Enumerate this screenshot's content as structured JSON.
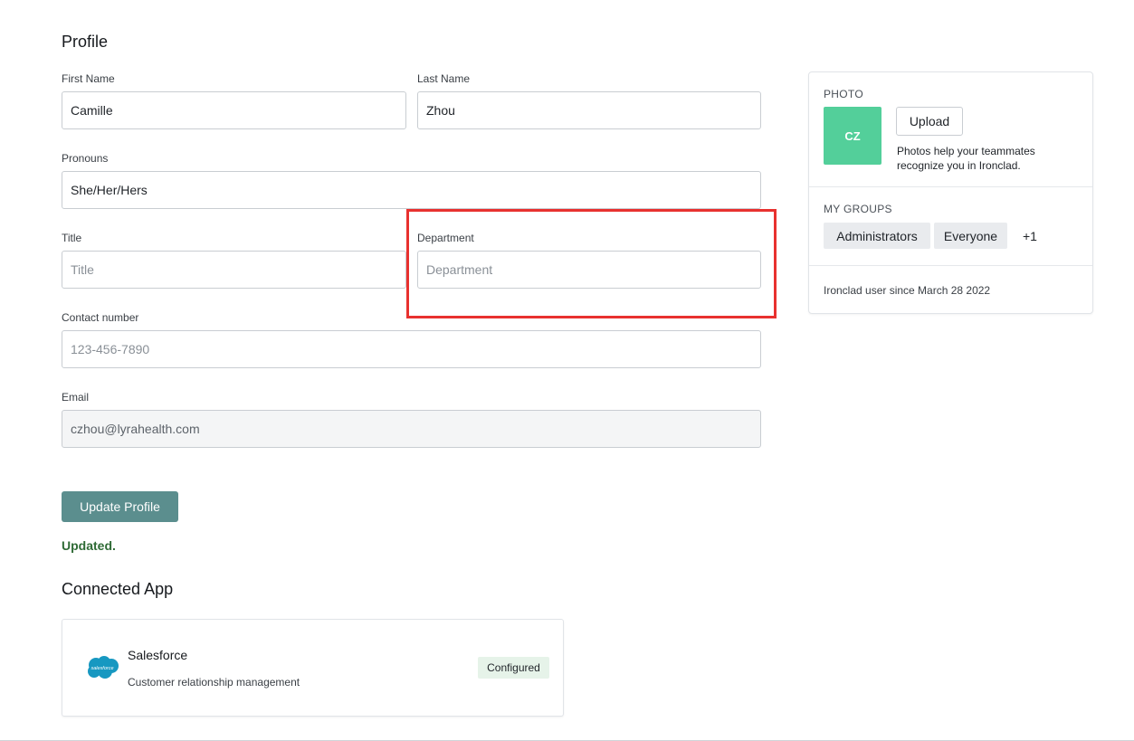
{
  "profile": {
    "title": "Profile",
    "fields": {
      "first_name": {
        "label": "First Name",
        "value": "Camille"
      },
      "last_name": {
        "label": "Last Name",
        "value": "Zhou"
      },
      "pronouns": {
        "label": "Pronouns",
        "value": "She/Her/Hers"
      },
      "title": {
        "label": "Title",
        "value": "",
        "placeholder": "Title"
      },
      "department": {
        "label": "Department",
        "value": "",
        "placeholder": "Department"
      },
      "contact": {
        "label": "Contact number",
        "value": "",
        "placeholder": "123-456-7890"
      },
      "email": {
        "label": "Email",
        "value": "czhou@lyrahealth.com"
      }
    },
    "update_button": "Update Profile",
    "status": "Updated."
  },
  "sidebar": {
    "photo_caption": "PHOTO",
    "avatar_initials": "CZ",
    "upload_button": "Upload",
    "photo_help": "Photos help your teammates recognize you in Ironclad.",
    "groups_caption": "MY GROUPS",
    "groups": [
      "Administrators",
      "Everyone"
    ],
    "groups_more": "+1",
    "member_since": "Ironclad user since March 28 2022"
  },
  "connected_app": {
    "title": "Connected App",
    "app": {
      "name": "Salesforce",
      "description": "Customer relationship management",
      "status": "Configured",
      "logo_text": "salesforce",
      "logo_icon": "salesforce-cloud-icon"
    }
  },
  "colors": {
    "primary_button": "#5b8e8e",
    "avatar": "#53cf9a",
    "highlight": "#e8312f",
    "status_green": "#2f6b36",
    "salesforce_blue": "#1798c1"
  }
}
